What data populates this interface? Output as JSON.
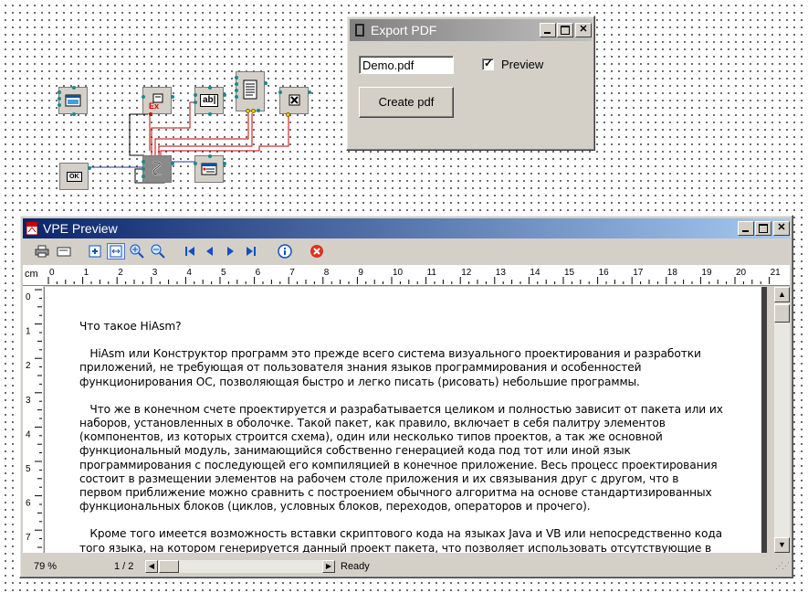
{
  "export_window": {
    "title": "Export PDF",
    "filename_value": "Demo.pdf",
    "preview_label": "Preview",
    "preview_checked": true,
    "create_button": "Create pdf"
  },
  "components": {
    "ok_label": "OK",
    "ex_label": "Ex",
    "edit_label": "ab|"
  },
  "vpe": {
    "title": "VPE Preview",
    "ruler_unit": "cm",
    "ruler_h_numbers": [
      "0",
      "1",
      "2",
      "3",
      "4",
      "5",
      "6",
      "7",
      "8",
      "9",
      "10",
      "11",
      "12",
      "13",
      "14",
      "15",
      "16",
      "17",
      "18",
      "19",
      "20",
      "21"
    ],
    "ruler_v_numbers": [
      "0",
      "1",
      "2",
      "3",
      "4",
      "5",
      "6",
      "7"
    ],
    "document": {
      "heading": "Что такое HiAsm?",
      "paragraphs": [
        [
          "   HiAsm или Конструктор программ это прежде всего система визуального проектирования и разработки",
          "приложений, не требующая от пользователя знания языков программирования и особенностей",
          "функционирования ОС, позволяющая быстро и легко писать (рисовать) небольшие программы."
        ],
        [
          "   Что же в конечном счете проектируется и разрабатывается целиком и полностью зависит от пакета или их",
          "наборов, установленных в оболочке. Такой пакет, как правило, включает в себя палитру элементов",
          "(компонентов, из которых строится схема), один или несколько типов проектов, а так же основной",
          "функциональный модуль, занимающийся собственно генерацией кода под тот или иной язык",
          "программирования с последующей его компиляцией в конечное приложение. Весь процесс проектирования",
          "состоит в размещении элементов на рабочем столе приложения и их связывания друг с другом, что в",
          "первом приближение можно сравнить с построением обычного алгоритма на основе стандартизированных",
          "функциональных блоков (циклов, условных блоков, переходов, операторов и прочего)."
        ],
        [
          "   Кроме того имеется возможность вставки скриптового кода на языках Java и VB или непосредственно кода",
          "того языка, на котором генерируется данный проект пакета, что позволяет использовать отсутствующие в"
        ]
      ]
    },
    "status": {
      "zoom": "79 %",
      "page": "1 / 2",
      "state": "Ready"
    }
  }
}
